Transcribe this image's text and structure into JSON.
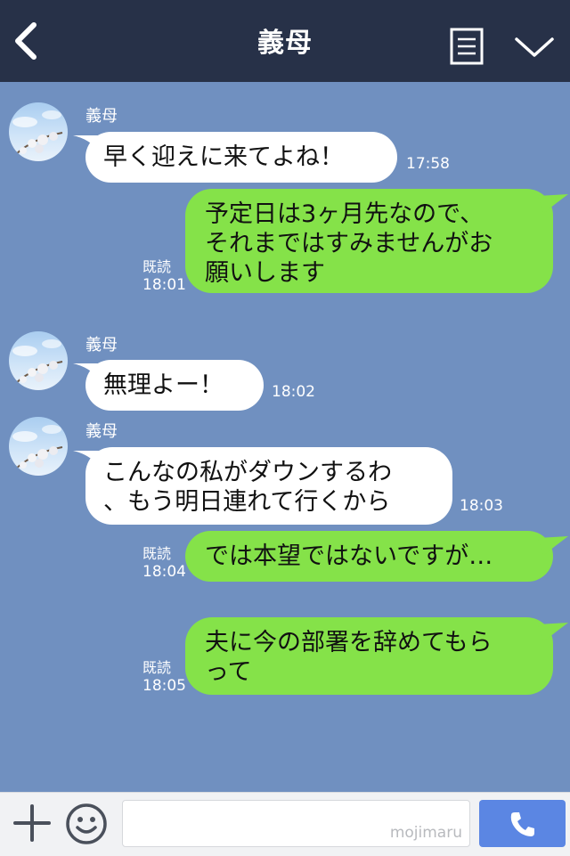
{
  "header": {
    "title": "義母",
    "icons": [
      "back-icon",
      "note-icon",
      "chevron-down-icon"
    ]
  },
  "messages": [
    {
      "side": "in",
      "sender": "義母",
      "text": "早く迎えに来てよね！",
      "time": "17:58"
    },
    {
      "side": "out",
      "read": "既読",
      "text": "予定日は3ヶ月先なので、\nそれまではすみませんがお\n願いします",
      "time": "18:01"
    },
    {
      "side": "in",
      "sender": "義母",
      "text": "無理よー！",
      "time": "18:02"
    },
    {
      "side": "in",
      "sender": "義母",
      "text": "こんなの私がダウンするわ\n、もう明日連れて行くから",
      "time": "18:03"
    },
    {
      "side": "out",
      "read": "既読",
      "text": "では本望ではないですが…",
      "time": "18:04"
    },
    {
      "side": "out",
      "read": "既読",
      "text": "夫に今の部署を辞めてもら\nって",
      "time": "18:05"
    }
  ],
  "footer": {
    "input_value": "",
    "watermark": "mojimaru",
    "icons": [
      "plus-icon",
      "smile-icon",
      "phone-icon"
    ]
  },
  "colors": {
    "header_bg": "#273148",
    "chat_bg": "#7090c0",
    "incoming_bubble": "#ffffff",
    "outgoing_bubble": "#85e249",
    "call_button": "#5b86e3"
  }
}
